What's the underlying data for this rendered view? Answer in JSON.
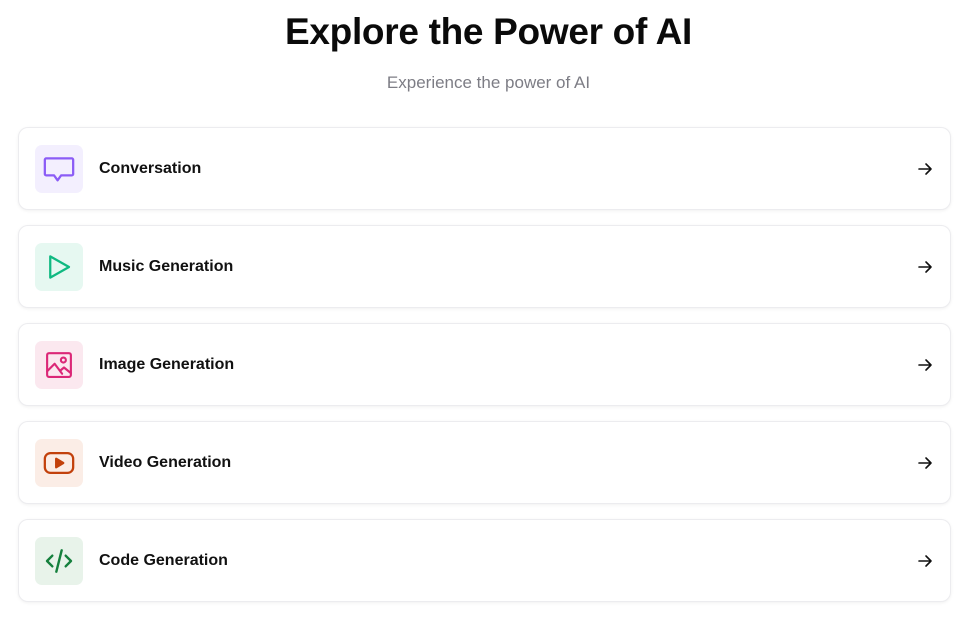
{
  "header": {
    "title": "Explore the Power of AI",
    "subtitle": "Experience the power of AI"
  },
  "tools": [
    {
      "label": "Conversation",
      "icon": "message-square-icon",
      "icon_color": "#8b5cf6",
      "icon_bg": "#f3effe"
    },
    {
      "label": "Music Generation",
      "icon": "play-icon",
      "icon_color": "#10b981",
      "icon_bg": "#e6f8f1"
    },
    {
      "label": "Image Generation",
      "icon": "image-icon",
      "icon_color": "#db2777",
      "icon_bg": "#fbe8ef"
    },
    {
      "label": "Video Generation",
      "icon": "video-icon",
      "icon_color": "#c2410c",
      "icon_bg": "#fbede6"
    },
    {
      "label": "Code Generation",
      "icon": "code-icon",
      "icon_color": "#15803d",
      "icon_bg": "#e8f3ea"
    }
  ]
}
